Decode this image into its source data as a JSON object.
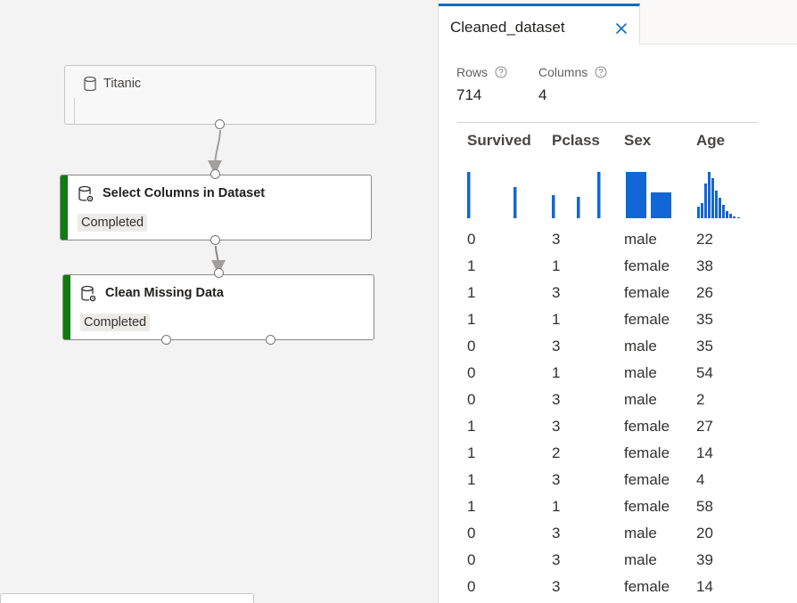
{
  "pipeline": {
    "nodes": [
      {
        "id": "titanic",
        "title": "Titanic",
        "status": ""
      },
      {
        "id": "select",
        "title": "Select Columns in Dataset",
        "status": "Completed"
      },
      {
        "id": "clean",
        "title": "Clean Missing Data",
        "status": "Completed"
      }
    ]
  },
  "panel": {
    "tab_title": "Cleaned_dataset",
    "rows_label": "Rows",
    "rows_value": "714",
    "columns_label": "Columns",
    "columns_value": "4",
    "accent_color": "#0f6cbd",
    "status_color": "#107c10",
    "histogram_color": "#1366d6"
  },
  "table": {
    "columns": [
      "Survived",
      "Pclass",
      "Sex",
      "Age"
    ],
    "rows": [
      [
        "0",
        "3",
        "male",
        "22"
      ],
      [
        "1",
        "1",
        "female",
        "38"
      ],
      [
        "1",
        "3",
        "female",
        "26"
      ],
      [
        "1",
        "1",
        "female",
        "35"
      ],
      [
        "0",
        "3",
        "male",
        "35"
      ],
      [
        "0",
        "1",
        "male",
        "54"
      ],
      [
        "0",
        "3",
        "male",
        "2"
      ],
      [
        "1",
        "3",
        "female",
        "27"
      ],
      [
        "1",
        "2",
        "female",
        "14"
      ],
      [
        "1",
        "3",
        "female",
        "4"
      ],
      [
        "1",
        "1",
        "female",
        "58"
      ],
      [
        "0",
        "3",
        "male",
        "20"
      ],
      [
        "0",
        "3",
        "male",
        "39"
      ],
      [
        "0",
        "3",
        "female",
        "14"
      ]
    ]
  },
  "icons": {
    "dataset": "database-icon",
    "module": "database-gear-icon",
    "help": "help-circle-icon",
    "close": "close-icon"
  }
}
